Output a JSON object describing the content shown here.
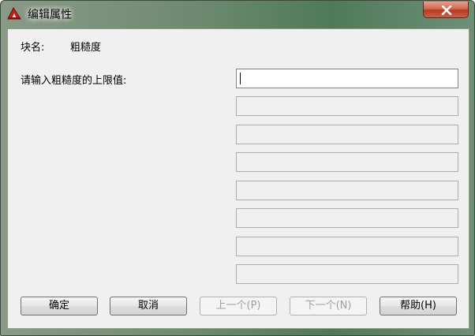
{
  "window": {
    "title": "编辑属性",
    "icon": "autocad-icon",
    "close_icon": "close-icon"
  },
  "block": {
    "name_label": "块名:",
    "name_value": "粗糙度"
  },
  "prompt": {
    "label": "请输入粗糙度的上限值:",
    "value": ""
  },
  "buttons": {
    "ok": "确定",
    "cancel": "取消",
    "prev": "上一个(P)",
    "next": "下一个(N)",
    "help": "帮助(H)"
  },
  "colors": {
    "close_button": "#c8503a",
    "dialog_background": "#f0f0f0"
  }
}
